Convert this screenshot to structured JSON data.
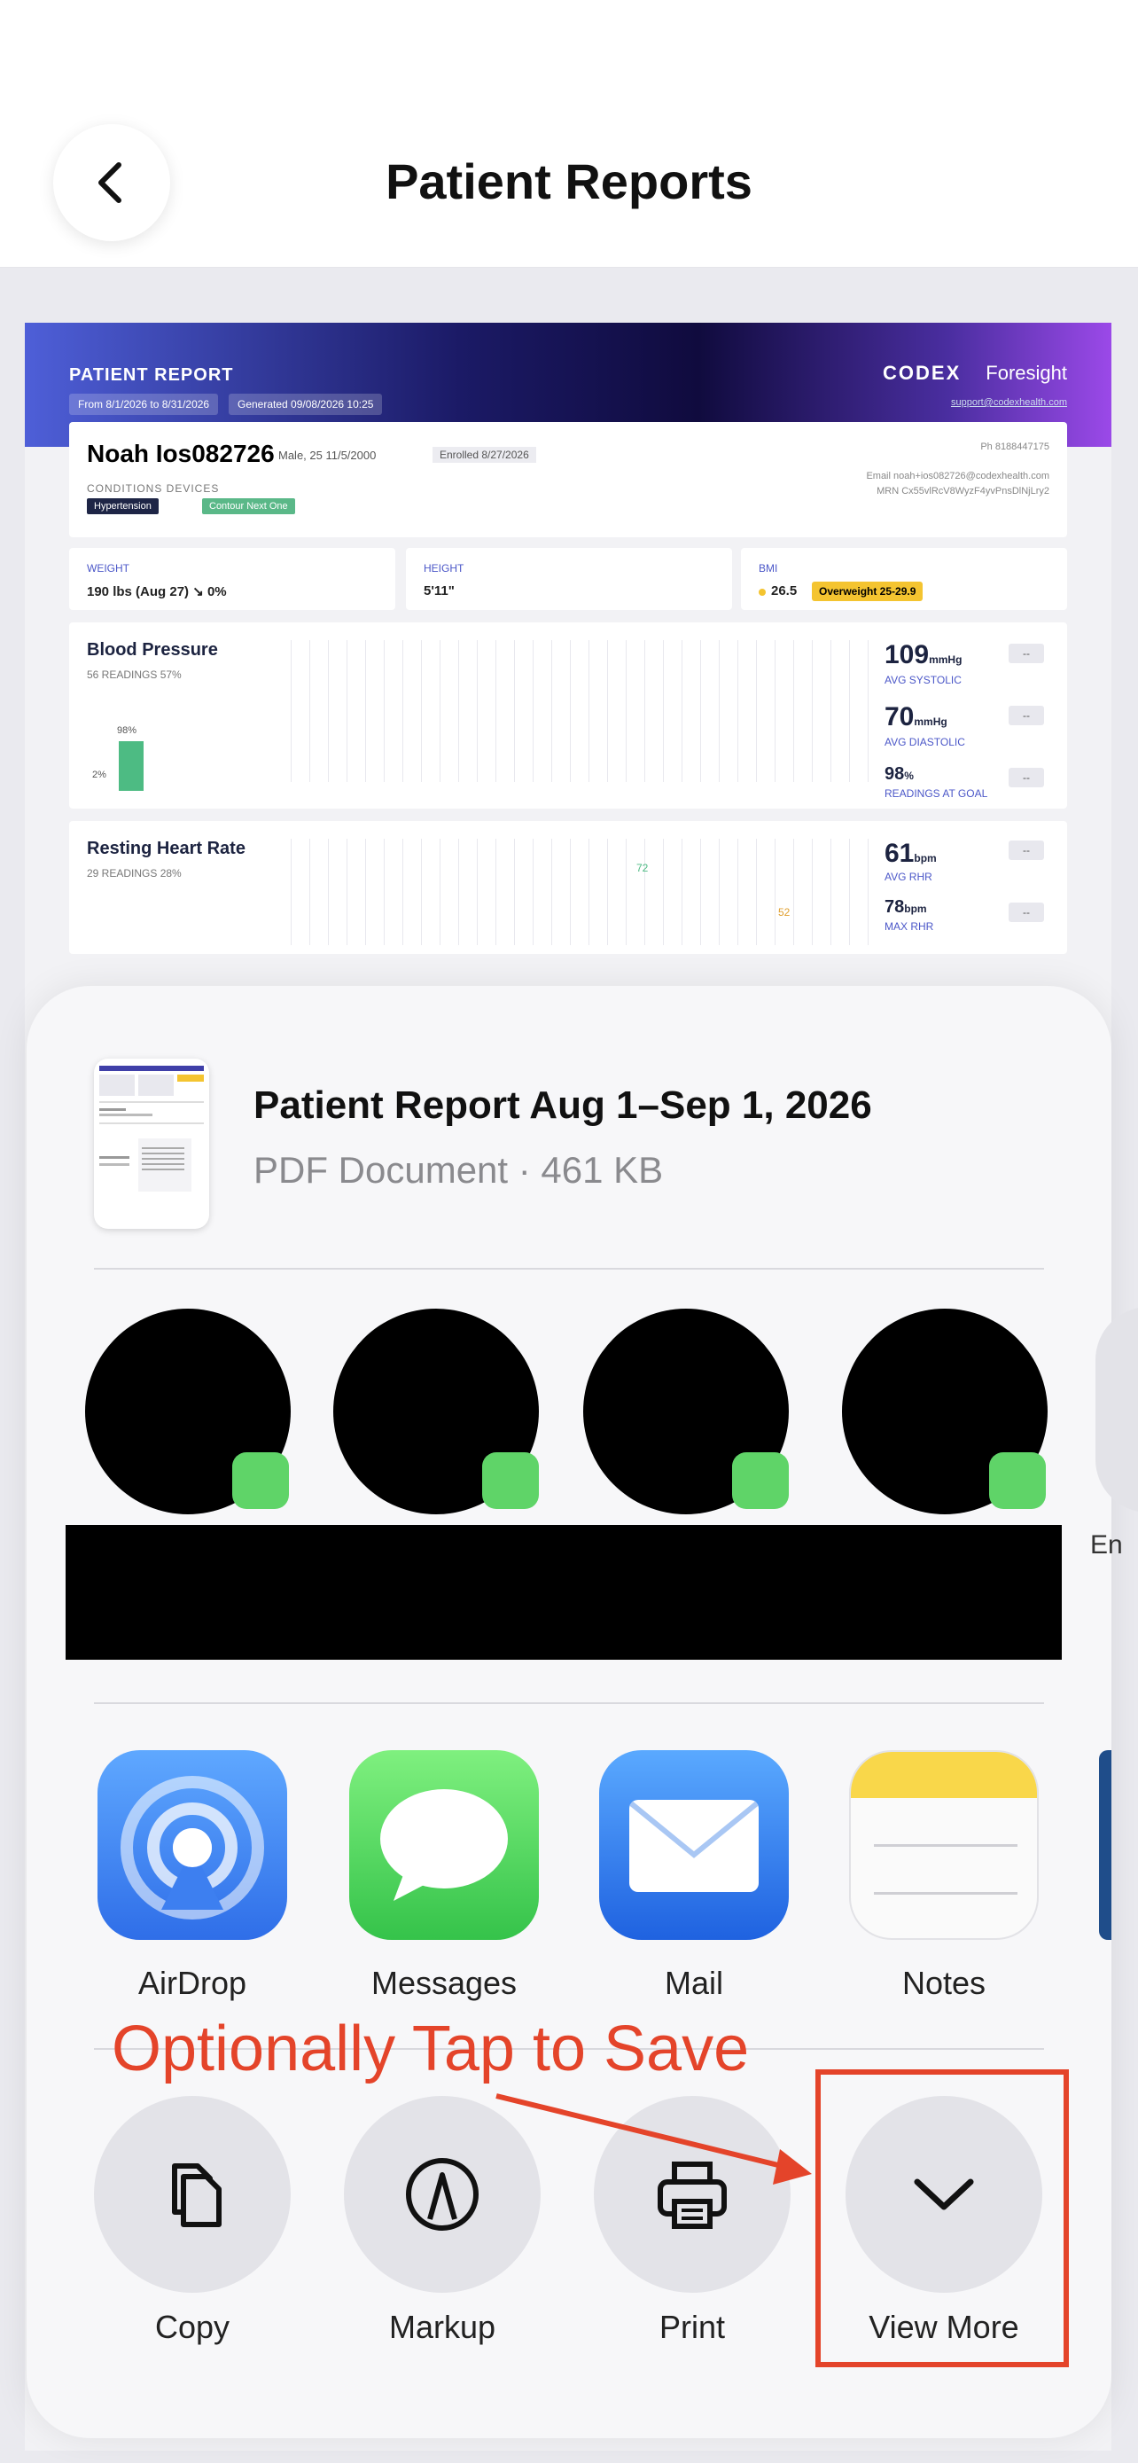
{
  "nav": {
    "title": "Patient Reports",
    "back_icon": "chevron-left-icon"
  },
  "report": {
    "header_title": "PATIENT REPORT",
    "date_range": "From 8/1/2026 to 8/31/2026",
    "generated": "Generated 09/08/2026 10:25",
    "brand_codex": "CODEX",
    "brand_foresight": "Foresight",
    "support_link": "support@codexhealth.com",
    "patient_name": "Noah Ios082726",
    "patient_meta": "Male, 25   11/5/2000",
    "enrolled": "Enrolled 8/27/2026",
    "conditions_label": "CONDITIONS   DEVICES",
    "condition_tag": "Hypertension",
    "device_tag": "Contour Next One",
    "phone": "Ph 8188447175",
    "email": "Email noah+ios082726@codexhealth.com",
    "mrn": "MRN Cx55vlRcV8WyzF4yvPnsDlNjLry2",
    "weight_label": "WEIGHT",
    "weight_value": "190 lbs (Aug 27)  ↘ 0%",
    "height_label": "HEIGHT",
    "height_value": "5'11\"",
    "bmi_label": "BMI",
    "bmi_value": "26.5",
    "bmi_badge": "Overweight 25-29.9",
    "bp_title": "Blood Pressure",
    "bp_sub": "56 READINGS  57%",
    "bp_pct": "98%",
    "bp_small_pct": "2%",
    "avg_systolic": "109",
    "avg_systolic_unit": "mmHg",
    "avg_systolic_label": "AVG SYSTOLIC",
    "avg_diastolic": "70",
    "avg_diastolic_unit": "mmHg",
    "avg_diastolic_label": "AVG DIASTOLIC",
    "readings_at_goal": "98",
    "readings_at_goal_unit": "%",
    "readings_at_goal_label": "READINGS AT GOAL",
    "hr_title": "Resting Heart Rate",
    "hr_sub": "29 READINGS  28%",
    "hr_peak": "72",
    "hr_low": "52",
    "avg_rhr": "61",
    "avg_rhr_unit": "bpm",
    "avg_rhr_label": "AVG RHR",
    "max_rhr": "78",
    "max_rhr_unit": "bpm",
    "max_rhr_label": "MAX RHR",
    "dash": "--"
  },
  "share": {
    "file_title": "Patient Report Aug 1–Sep 1, 2026",
    "file_sub": "PDF Document · 461 KB",
    "cut_label": "En",
    "apps": [
      {
        "label": "AirDrop",
        "icon": "airdrop-icon"
      },
      {
        "label": "Messages",
        "icon": "messages-icon"
      },
      {
        "label": "Mail",
        "icon": "mail-icon"
      },
      {
        "label": "Notes",
        "icon": "notes-icon"
      }
    ],
    "actions": [
      {
        "label": "Copy",
        "icon": "copy-icon"
      },
      {
        "label": "Markup",
        "icon": "markup-icon"
      },
      {
        "label": "Print",
        "icon": "print-icon"
      },
      {
        "label": "View More",
        "icon": "chevron-down-icon"
      }
    ]
  },
  "annotation": {
    "text": "Optionally Tap to Save",
    "color": "#e4442a"
  }
}
